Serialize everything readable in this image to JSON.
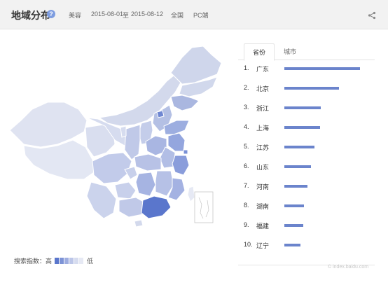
{
  "header": {
    "title": "地域分布",
    "help_glyph": "?",
    "category": "美容",
    "date_from": "2015-08-01",
    "date_sep": "至",
    "date_to": "2015-08-12",
    "region": "全国",
    "device": "PC端"
  },
  "tabs": [
    {
      "label": "省份",
      "active": true
    },
    {
      "label": "城市",
      "active": false
    }
  ],
  "ranking": [
    {
      "rank": "1.",
      "name": "广东",
      "value": 1.0
    },
    {
      "rank": "2.",
      "name": "北京",
      "value": 0.72
    },
    {
      "rank": "3.",
      "name": "浙江",
      "value": 0.48
    },
    {
      "rank": "4.",
      "name": "上海",
      "value": 0.47
    },
    {
      "rank": "5.",
      "name": "江苏",
      "value": 0.4
    },
    {
      "rank": "6.",
      "name": "山东",
      "value": 0.35
    },
    {
      "rank": "7.",
      "name": "河南",
      "value": 0.31
    },
    {
      "rank": "8.",
      "name": "湖南",
      "value": 0.26
    },
    {
      "rank": "9.",
      "name": "福建",
      "value": 0.25
    },
    {
      "rank": "10.",
      "name": "辽宁",
      "value": 0.21
    }
  ],
  "legend": {
    "label": "搜索指数：高",
    "low": "低",
    "colors": [
      "#5a76cc",
      "#7d93d6",
      "#9eade0",
      "#bcc6e8",
      "#d6dcef",
      "#e6e9f4"
    ]
  },
  "map": {
    "high_color": "#5a76cc",
    "base_color": "#d3d9ec"
  },
  "bar_color": "#6b84cc",
  "watermark": "© index.baidu.com"
}
